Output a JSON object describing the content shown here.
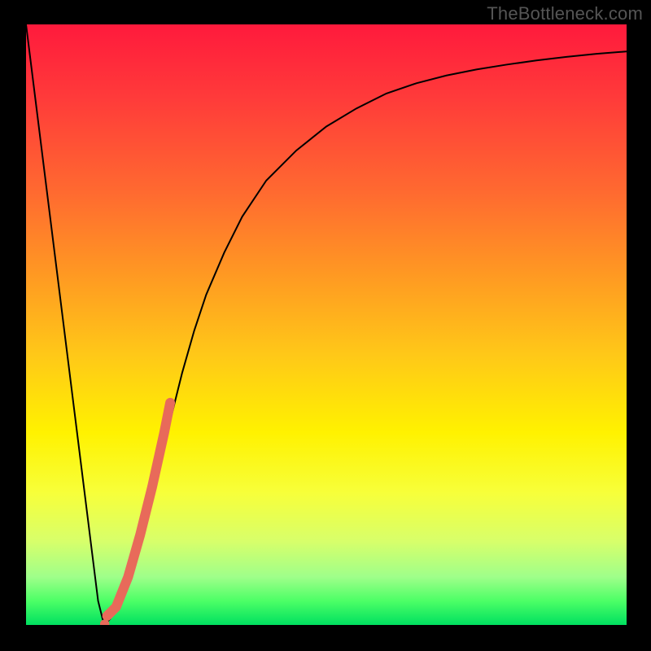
{
  "watermark": "TheBottleneck.com",
  "chart_data": {
    "type": "line",
    "title": "",
    "xlabel": "",
    "ylabel": "",
    "xlim": [
      0,
      100
    ],
    "ylim": [
      0,
      100
    ],
    "grid": false,
    "background_gradient_stops": [
      {
        "pos": 0,
        "color": "#ff1a3c"
      },
      {
        "pos": 12,
        "color": "#ff3a3a"
      },
      {
        "pos": 28,
        "color": "#ff6a30"
      },
      {
        "pos": 42,
        "color": "#ff9a22"
      },
      {
        "pos": 55,
        "color": "#ffc818"
      },
      {
        "pos": 68,
        "color": "#fff200"
      },
      {
        "pos": 78,
        "color": "#f7ff3a"
      },
      {
        "pos": 86,
        "color": "#d8ff6a"
      },
      {
        "pos": 92,
        "color": "#9fff8a"
      },
      {
        "pos": 96,
        "color": "#4cff66"
      },
      {
        "pos": 100,
        "color": "#00e060"
      }
    ],
    "series": [
      {
        "name": "bottleneck-curve",
        "color": "#000000",
        "stroke_width": 2,
        "x": [
          0,
          2,
          4,
          6,
          8,
          10,
          11,
          12,
          13,
          14,
          15,
          16,
          18,
          20,
          22,
          24,
          26,
          28,
          30,
          33,
          36,
          40,
          45,
          50,
          55,
          60,
          65,
          70,
          75,
          80,
          85,
          90,
          95,
          100
        ],
        "y": [
          100,
          84,
          68,
          52,
          36,
          20,
          12,
          4,
          0,
          1,
          3,
          6,
          12,
          18,
          26,
          34,
          42,
          49,
          55,
          62,
          68,
          74,
          79,
          83,
          86,
          88.5,
          90.2,
          91.5,
          92.5,
          93.3,
          94,
          94.6,
          95.1,
          95.5
        ]
      },
      {
        "name": "highlighted-segment",
        "color": "#e86a5a",
        "stroke_width": 12,
        "linecap": "round",
        "x": [
          13.5,
          15,
          17,
          19,
          21,
          23,
          24
        ],
        "y": [
          1.5,
          3,
          8,
          15,
          23,
          32,
          37
        ]
      },
      {
        "name": "highlight-dot",
        "color": "#e86a5a",
        "stroke_width": 10,
        "linecap": "round",
        "x": [
          13,
          13.2
        ],
        "y": [
          0.2,
          0.2
        ]
      }
    ]
  }
}
